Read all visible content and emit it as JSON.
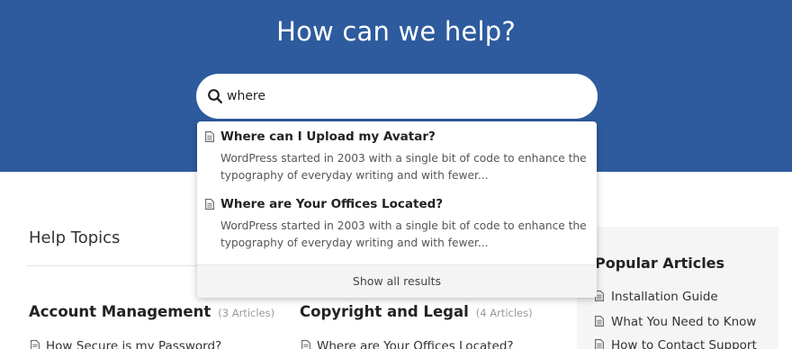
{
  "hero": {
    "title": "How can we help?",
    "background_color": "#2d5b9e"
  },
  "search": {
    "value": "where",
    "icon": "search-icon"
  },
  "dropdown": {
    "results": [
      {
        "title": "Where can I Upload my Avatar?",
        "excerpt": "WordPress started in 2003 with a single bit of code to enhance the typography of everyday writing and with fewer...",
        "icon": "document-icon"
      },
      {
        "title": "Where are Your Offices Located?",
        "excerpt": "WordPress started in 2003 with a single bit of code to enhance the typography of everyday writing and with fewer...",
        "icon": "document-icon"
      }
    ],
    "show_all_label": "Show all results"
  },
  "help_topics": {
    "heading": "Help Topics",
    "categories": [
      {
        "title": "Account Management",
        "count": "(3 Articles)",
        "first_link": "How Secure is my Password?"
      },
      {
        "title": "Copyright and Legal",
        "count": "(4 Articles)",
        "first_link": "Where are Your Offices Located?"
      }
    ]
  },
  "popular": {
    "heading": "Popular Articles",
    "items": [
      "Installation Guide",
      "What You Need to Know",
      "How to Contact Support"
    ]
  }
}
